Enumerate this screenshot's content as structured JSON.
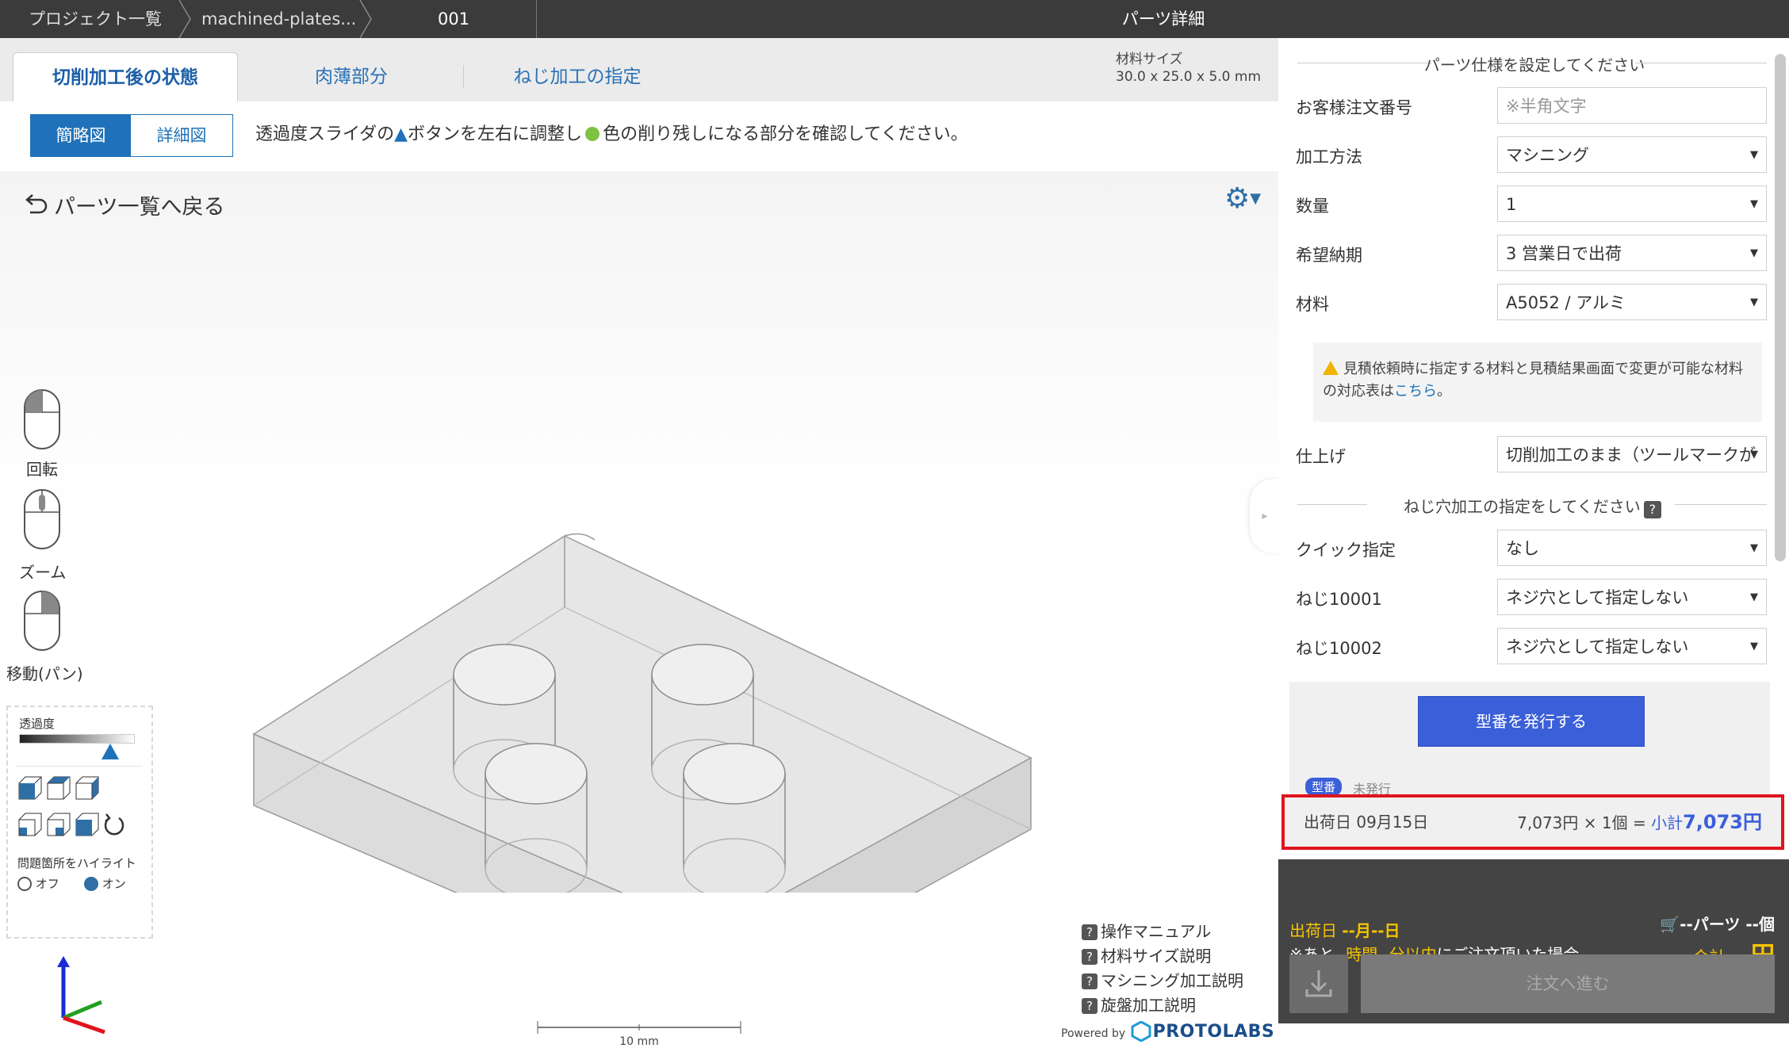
{
  "breadcrumb": {
    "projects": "プロジェクト一覧",
    "file": "machined-plates...",
    "part_no": "001"
  },
  "window_title": "パーツ詳細",
  "tabs": [
    "切削加工後の状態",
    "肉薄部分",
    "ねじ加工の指定"
  ],
  "material_size": {
    "label": "材料サイズ",
    "value": "30.0 x 25.0 x 5.0 mm"
  },
  "view_toggle": {
    "simple": "簡略図",
    "detailed": "詳細図"
  },
  "instruction": {
    "before": "透過度スライダの",
    "tri": "▲",
    "mid": "ボタンを左右に調整し",
    "after": "色の削り残しになる部分を確認してください。"
  },
  "back_link": "パーツ一覧へ戻る",
  "mouse_controls": [
    "回転",
    "ズーム",
    "移動(パン)"
  ],
  "transparency_label": "透過度",
  "transparency_level": 0.8,
  "highlight": {
    "label": "問題箇所をハイライト",
    "off": "オフ",
    "on": "オン",
    "selected": "on"
  },
  "help_links": [
    "操作マニュアル",
    "材料サイズ説明",
    "マシニング加工説明",
    "旋盤加工説明"
  ],
  "powered_by": {
    "prefix": "Powered by",
    "brand": "PROTOLABS"
  },
  "scale_bar": "10 mm",
  "spec": {
    "heading": "パーツ仕様を設定してください",
    "order_no": {
      "label": "お客様注文番号",
      "placeholder": "※半角文字"
    },
    "method": {
      "label": "加工方法",
      "value": "マシニング"
    },
    "qty": {
      "label": "数量",
      "value": "1"
    },
    "delivery": {
      "label": "希望納期",
      "value": "3 営業日で出荷"
    },
    "material": {
      "label": "材料",
      "value": "A5052 / アルミ"
    },
    "note_text": "見積依頼時に指定する材料と見積結果画面で変更が可能な材料の対応表は",
    "note_link": "こちら",
    "note_end": "。",
    "finish": {
      "label": "仕上げ",
      "value": "切削加工のまま（ツールマークが"
    }
  },
  "thread": {
    "heading": "ねじ穴加工の指定をしてください",
    "quick": {
      "label": "クイック指定",
      "value": "なし"
    },
    "t1": {
      "label": "ねじ10001",
      "value": "ネジ穴として指定しない"
    },
    "t2": {
      "label": "ねじ10002",
      "value": "ネジ穴として指定しない"
    }
  },
  "issue_button": "型番を発行する",
  "kataban": {
    "badge": "型番",
    "status": "未発行"
  },
  "price_row": {
    "ship": "出荷日 09月15日",
    "calc": "7,073円 × 1個 = ",
    "sub_label": "小計",
    "subtotal": "7,073円"
  },
  "footer": {
    "ship_label": "出荷日 ",
    "ship_value": "--月--日",
    "remain_prefix": "※あと",
    "remain_value": "--時間--分以内",
    "remain_suffix": "にご注文頂いた場合",
    "parts": "--パーツ --個",
    "total_label": "合計 ",
    "total_value": "--円",
    "order_button": "注文へ進む"
  },
  "colors": {
    "accent": "#1f72b9",
    "issue": "#3b5fd9",
    "highlight_red": "#e0141e",
    "footer_yellow": "#f5c400"
  }
}
